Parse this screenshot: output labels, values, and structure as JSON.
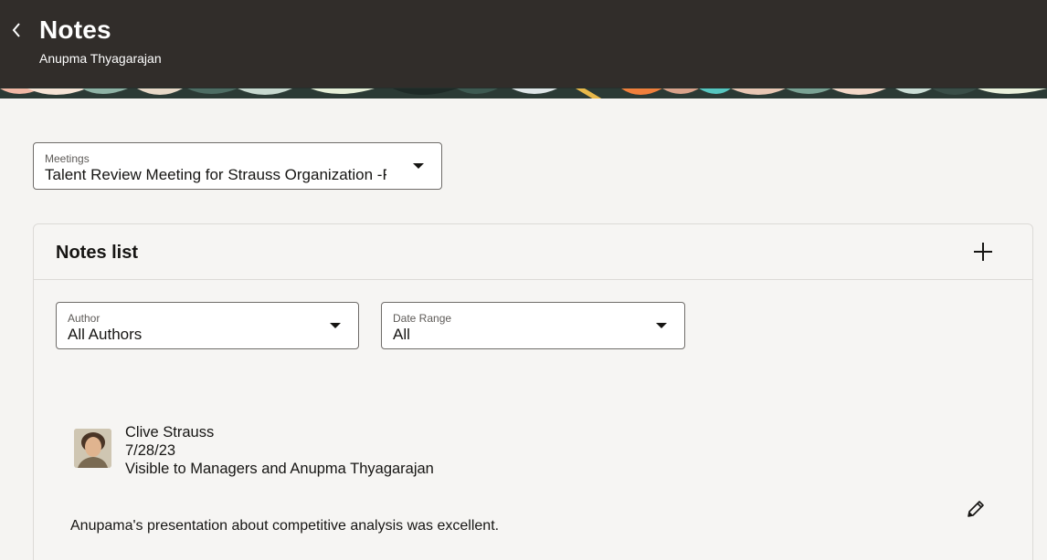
{
  "header": {
    "title": "Notes",
    "subtitle": "Anupma Thyagarajan",
    "back_icon": "chevron-left-icon",
    "background": "#312d2a"
  },
  "meetings": {
    "label": "Meetings",
    "value": "Talent Review Meeting for Strauss Organization -FY:"
  },
  "notes_list": {
    "title": "Notes list",
    "add_icon": "plus-icon",
    "filters": {
      "author": {
        "label": "Author",
        "value": "All Authors"
      },
      "date_range": {
        "label": "Date Range",
        "value": "All"
      }
    },
    "notes": [
      {
        "author": "Clive Strauss",
        "date": "7/28/23",
        "visibility": "Visible to Managers and Anupma Thyagarajan",
        "text": "Anupama's presentation about competitive analysis was excellent.",
        "edit_icon": "pencil-icon"
      }
    ]
  }
}
